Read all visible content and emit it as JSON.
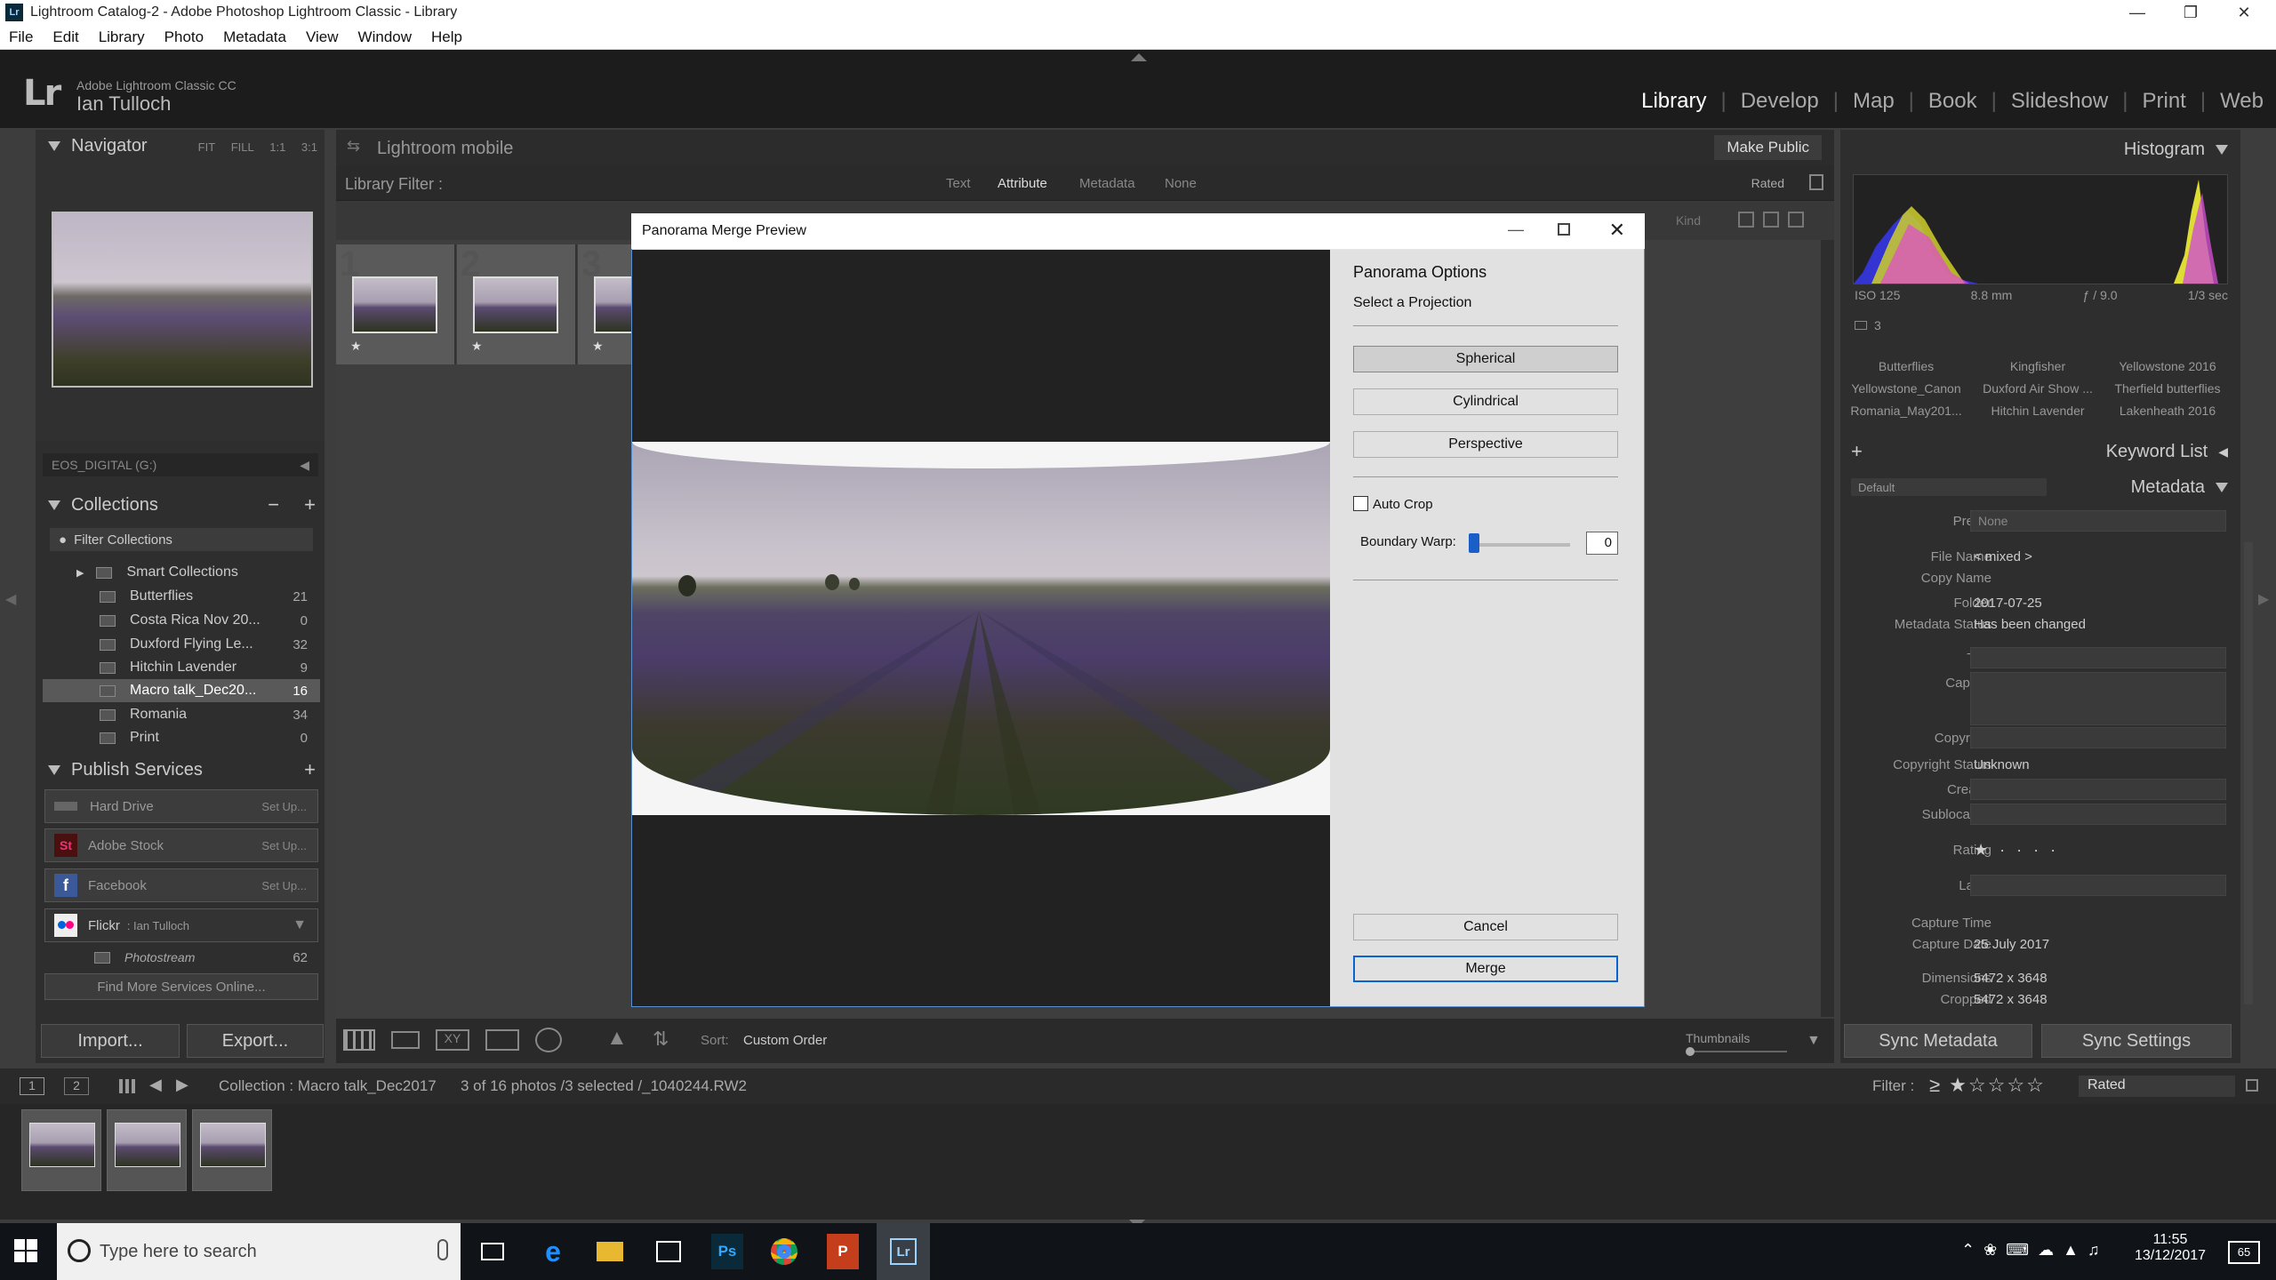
{
  "window": {
    "title": "Lightroom Catalog-2 - Adobe Photoshop Lightroom Classic - Library",
    "app_icon": "Lr"
  },
  "menu": [
    "File",
    "Edit",
    "Library",
    "Photo",
    "Metadata",
    "View",
    "Window",
    "Help"
  ],
  "identity": {
    "product": "Adobe Lightroom Classic CC",
    "user": "Ian Tulloch"
  },
  "modules": [
    "Library",
    "Develop",
    "Map",
    "Book",
    "Slideshow",
    "Print",
    "Web"
  ],
  "navigator": {
    "title": "Navigator",
    "opts": [
      "FIT",
      "FILL",
      "1:1",
      "3:1"
    ]
  },
  "volume": "EOS_DIGITAL (G:)",
  "collections": {
    "title": "Collections",
    "filter": "Filter Collections",
    "smart": "Smart Collections",
    "items": [
      {
        "name": "Butterflies",
        "count": "21"
      },
      {
        "name": "Costa Rica Nov 20...",
        "count": "0"
      },
      {
        "name": "Duxford Flying Le...",
        "count": "32"
      },
      {
        "name": "Hitchin Lavender",
        "count": "9"
      },
      {
        "name": "Macro talk_Dec20...",
        "count": "16"
      },
      {
        "name": "Romania",
        "count": "34"
      },
      {
        "name": "Print",
        "count": "0"
      }
    ]
  },
  "publish": {
    "title": "Publish Services",
    "services": [
      {
        "name": "Hard Drive",
        "action": "Set Up..."
      },
      {
        "name": "Adobe Stock",
        "action": "Set Up..."
      },
      {
        "name": "Facebook",
        "action": "Set Up..."
      }
    ],
    "flickr": {
      "name": "Flickr",
      "account": ": Ian Tulloch"
    },
    "photostream": {
      "name": "Photostream",
      "count": "62"
    },
    "find_more": "Find More Services Online..."
  },
  "left_buttons": {
    "import": "Import...",
    "export": "Export..."
  },
  "center": {
    "mobile": "Lightroom mobile",
    "make_public": "Make Public",
    "filter_label": "Library Filter :",
    "filter_tabs": [
      "Text",
      "Attribute",
      "Metadata",
      "None"
    ],
    "rated": "Rated",
    "kind": "Kind",
    "cell_numbers": [
      "1",
      "2",
      "3"
    ]
  },
  "toolbar": {
    "sort_label": "Sort:",
    "sort_value": "Custom Order",
    "thumbnails": "Thumbnails"
  },
  "dialog": {
    "title": "Panorama Merge Preview",
    "options_title": "Panorama Options",
    "projection_label": "Select a Projection",
    "projections": [
      "Spherical",
      "Cylindrical",
      "Perspective"
    ],
    "auto_crop": "Auto Crop",
    "boundary_warp_label": "Boundary Warp:",
    "boundary_warp_value": "0",
    "cancel": "Cancel",
    "merge": "Merge"
  },
  "histogram": {
    "title": "Histogram",
    "iso": "ISO 125",
    "focal": "8.8 mm",
    "aperture": "ƒ / 9.0",
    "shutter": "1/3 sec",
    "count": "3"
  },
  "keywords": {
    "tags": [
      "Butterflies",
      "Kingfisher",
      "Yellowstone 2016",
      "Yellowstone_Canon",
      "Duxford Air Show ...",
      "Therfield butterflies",
      "Romania_May201...",
      "Hitchin Lavender",
      "Lakenheath 2016"
    ],
    "title": "Keyword List"
  },
  "metadata": {
    "title": "Metadata",
    "preset_set": "Default",
    "preset_label": "Preset",
    "preset_value": "None",
    "fields": [
      {
        "label": "File Name",
        "value": "< mixed >"
      },
      {
        "label": "Copy Name",
        "value": ""
      },
      {
        "label": "Folder",
        "value": "2017-07-25"
      },
      {
        "label": "Metadata Status",
        "value": "Has been changed"
      },
      {
        "label": "Title",
        "value": ""
      },
      {
        "label": "Caption",
        "value": ""
      },
      {
        "label": "Copyright",
        "value": ""
      },
      {
        "label": "Copyright Status",
        "value": "Unknown"
      },
      {
        "label": "Creator",
        "value": ""
      },
      {
        "label": "Sublocation",
        "value": ""
      },
      {
        "label": "Rating",
        "value": "★ · · · ·"
      },
      {
        "label": "Label",
        "value": ""
      },
      {
        "label": "Capture Time",
        "value": ""
      },
      {
        "label": "Capture Date",
        "value": "25 July 2017"
      },
      {
        "label": "Dimensions",
        "value": "5472 x 3648"
      },
      {
        "label": "Cropped",
        "value": "5472 x 3648"
      }
    ]
  },
  "sync": {
    "metadata": "Sync Metadata",
    "settings": "Sync Settings"
  },
  "filmstrip": {
    "page1": "1",
    "page2": "2",
    "source": "Collection : Macro talk_Dec2017",
    "status": "3 of 16 photos /3 selected /_1040244.RW2",
    "filter_label": "Filter :",
    "filter_value": "Rated"
  },
  "taskbar": {
    "search_placeholder": "Type here to search",
    "time": "11:55",
    "date": "13/12/2017",
    "notifications": "65"
  },
  "colors": {
    "accent": "#5a8fd0",
    "selected_row": "#595959"
  }
}
